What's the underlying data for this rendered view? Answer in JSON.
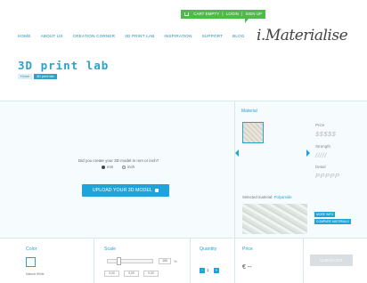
{
  "header": {
    "cart": {
      "empty": "CART EMPTY",
      "login": "LOGIN",
      "signup": "SIGN UP"
    },
    "nav": [
      "HOME",
      "ABOUT US",
      "CREATION CORNER",
      "3D PRINT LAB",
      "INSPIRATION",
      "SUPPORT",
      "BLOG"
    ],
    "logo": "i.Materialise"
  },
  "page": {
    "title": "3D print lab",
    "breadcrumb": [
      "Home",
      "3D print lab"
    ]
  },
  "upload": {
    "question": "Did you create your 3D model in mm or inch?",
    "unit_mm": "mm",
    "unit_inch": "inch",
    "button": "UPLOAD YOUR 3D MODEL"
  },
  "material": {
    "label": "Material",
    "price_label": "Price",
    "price_value": "$$$$$",
    "strength_label": "Strength",
    "strength_value": "/////",
    "detail_label": "Detail",
    "detail_value": "PPPPP",
    "selected_prefix": "Selected material:",
    "selected_name": "Polyamide",
    "more_info": "MORE INFO",
    "compare": "COMPARE MATERIALS"
  },
  "config": {
    "color_label": "Color",
    "color_name": "Natural White",
    "scale_label": "Scale",
    "scale_value": "100",
    "scale_unit": "%",
    "dims": [
      "0,00",
      "0,00",
      "0,00"
    ],
    "quantity_label": "Quantity",
    "quantity_minus": "-",
    "quantity_value": "1",
    "quantity_plus": "+",
    "price_label": "Price",
    "price_value": "€ --",
    "checkout": "CHECKOUT"
  },
  "colors": {
    "accent": "#1ea4d8",
    "green": "#4cbb47",
    "title": "#2ba2c9"
  }
}
